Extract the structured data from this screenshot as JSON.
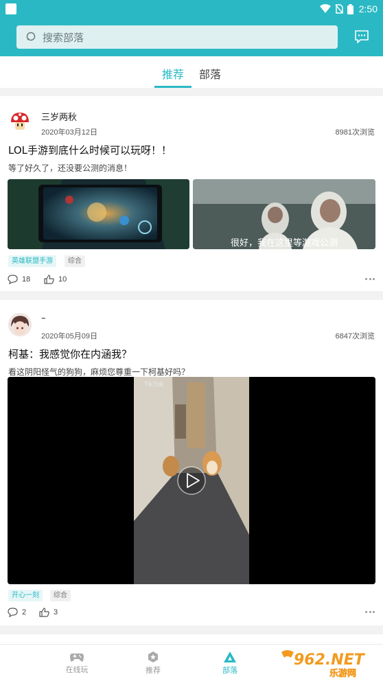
{
  "status": {
    "time": "2:50"
  },
  "search": {
    "placeholder": "搜索部落"
  },
  "tabs": [
    {
      "label": "推荐"
    },
    {
      "label": "部落"
    }
  ],
  "posts": [
    {
      "author": "三岁两秋",
      "date": "2020年03月12日",
      "views": "8981次浏览",
      "title": "LOL手游到底什么时候可以玩呀！！",
      "desc": "等了好久了，还没要公测的消息！",
      "image_caption": "很好，我在这里等游戏公测",
      "tags": [
        "英雄联盟手游",
        "综合"
      ],
      "comments": "18",
      "likes": "10"
    },
    {
      "author": "–",
      "date": "2020年05月09日",
      "views": "6847次浏览",
      "title": "柯基：我感觉你在内涵我？",
      "desc": "看这阴阳怪气的狗狗，麻烦您尊重一下柯基好吗？",
      "video_brand": "TikTok",
      "tags": [
        "开心一刻",
        "综合"
      ],
      "comments": "2",
      "likes": "3"
    }
  ],
  "bottom_nav": [
    {
      "label": "在线玩",
      "icon": "gamepad-icon"
    },
    {
      "label": "推荐",
      "icon": "hexagon-star-icon"
    },
    {
      "label": "部落",
      "icon": "triangle-tribe-icon"
    }
  ],
  "watermark": {
    "text": "962.NET",
    "sub": "乐游网"
  },
  "colors": {
    "accent": "#2ab9c4",
    "topbar": "#2ab9c4"
  }
}
